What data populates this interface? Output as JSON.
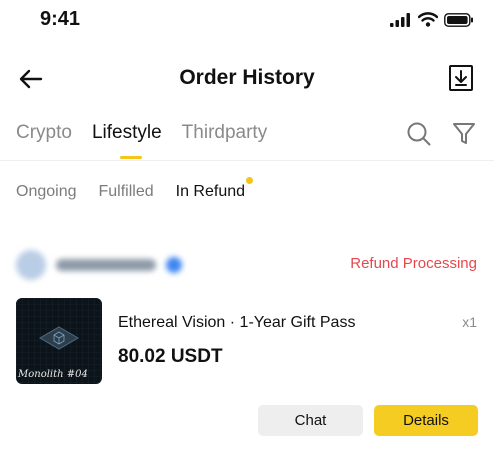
{
  "status_bar": {
    "time": "9:41"
  },
  "header": {
    "title": "Order History",
    "back_icon": "arrow-left-icon",
    "download_icon": "download-icon"
  },
  "tabs": [
    {
      "label": "Crypto",
      "active": false
    },
    {
      "label": "Lifestyle",
      "active": true
    },
    {
      "label": "Thirdparty",
      "active": false
    }
  ],
  "subtabs": [
    {
      "label": "Ongoing",
      "active": false
    },
    {
      "label": "Fulfilled",
      "active": false
    },
    {
      "label": "In Refund",
      "active": true,
      "has_dot": true
    }
  ],
  "order": {
    "status": "Refund Processing",
    "product_name": "Ethereal Vision · 1-Year Gift Pass",
    "quantity": "x1",
    "price": "80.02 USDT",
    "thumbnail_caption": "Monolith #04",
    "buttons": {
      "chat": "Chat",
      "details": "Details"
    }
  },
  "colors": {
    "accent": "#f5c518",
    "details_button": "#f5cd22",
    "refund_status": "#e5484d"
  }
}
